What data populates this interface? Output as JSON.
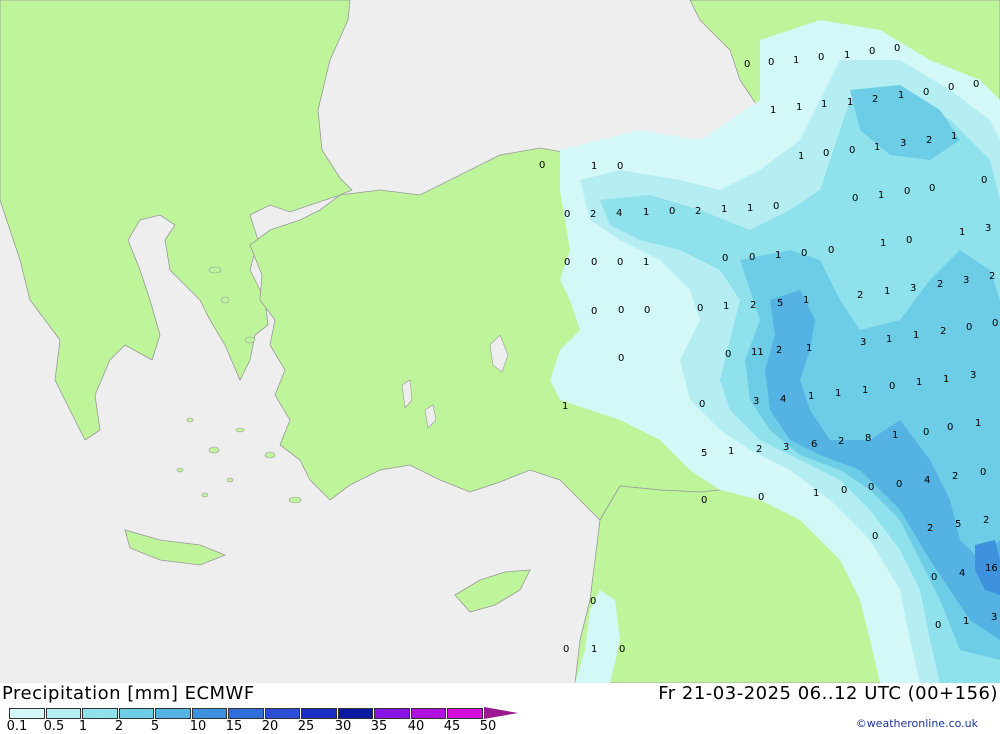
{
  "map": {
    "colors": {
      "sea": "#eeeeee",
      "land": "#bff59a",
      "border": "#999999",
      "precip_0_1": "#d4f7f7",
      "precip_0_5": "#b5eef2",
      "precip_1": "#8fe1ec",
      "precip_2": "#6dcde6",
      "precip_5": "#54b3e2",
      "precip_10": "#3e91dc",
      "precip_15": "#2f6fdb"
    },
    "point_labels": [
      "0",
      "0",
      "1",
      "0",
      "1",
      "0",
      "0",
      "1",
      "1",
      "1",
      "1",
      "2",
      "1",
      "0",
      "0",
      "0",
      "0",
      "1",
      "0",
      "1",
      "0",
      "0",
      "1",
      "3",
      "2",
      "1",
      "0",
      "2",
      "4",
      "1",
      "0",
      "2",
      "1",
      "1",
      "0",
      "0",
      "1",
      "0",
      "0",
      "0",
      "0",
      "0",
      "0",
      "1",
      "0",
      "0",
      "1",
      "0",
      "0",
      "1",
      "0",
      "1",
      "3",
      "0",
      "0",
      "0",
      "0",
      "1",
      "2",
      "5",
      "1",
      "2",
      "1",
      "3",
      "2",
      "3",
      "2",
      "0",
      "0",
      "11",
      "2",
      "1",
      "3",
      "1",
      "1",
      "2",
      "0",
      "0",
      "1",
      "1",
      "3",
      "0",
      "3",
      "4",
      "1",
      "1",
      "1",
      "0",
      "1",
      "0",
      "5",
      "1",
      "2",
      "3",
      "6",
      "2",
      "8",
      "1",
      "0",
      "1",
      "0",
      "0",
      "1",
      "0",
      "0",
      "0",
      "4",
      "2",
      "0",
      "2",
      "5",
      "2",
      "0",
      "0",
      "4",
      "16",
      "0",
      "0",
      "1",
      "3",
      "0",
      "1",
      "0"
    ]
  },
  "footer": {
    "title_left": "Precipitation [mm] ECMWF",
    "title_right": "Fr 21-03-2025 06..12 UTC (00+156)",
    "credit": "©weatheronline.co.uk"
  },
  "legend": {
    "labels": [
      "0.1",
      "0.5",
      "1",
      "2",
      "5",
      "10",
      "15",
      "20",
      "25",
      "30",
      "35",
      "40",
      "45",
      "50"
    ],
    "colors": [
      "#d4f7f7",
      "#b5eef2",
      "#8fe1ec",
      "#6dcde6",
      "#54b3e2",
      "#3e91dc",
      "#2f6fdb",
      "#2a4fd6",
      "#1c2fc4",
      "#0a1aa2",
      "#8a14e6",
      "#b010e0",
      "#d40cdc",
      "#c214c0"
    ],
    "arrow_color": "#9a1890"
  }
}
